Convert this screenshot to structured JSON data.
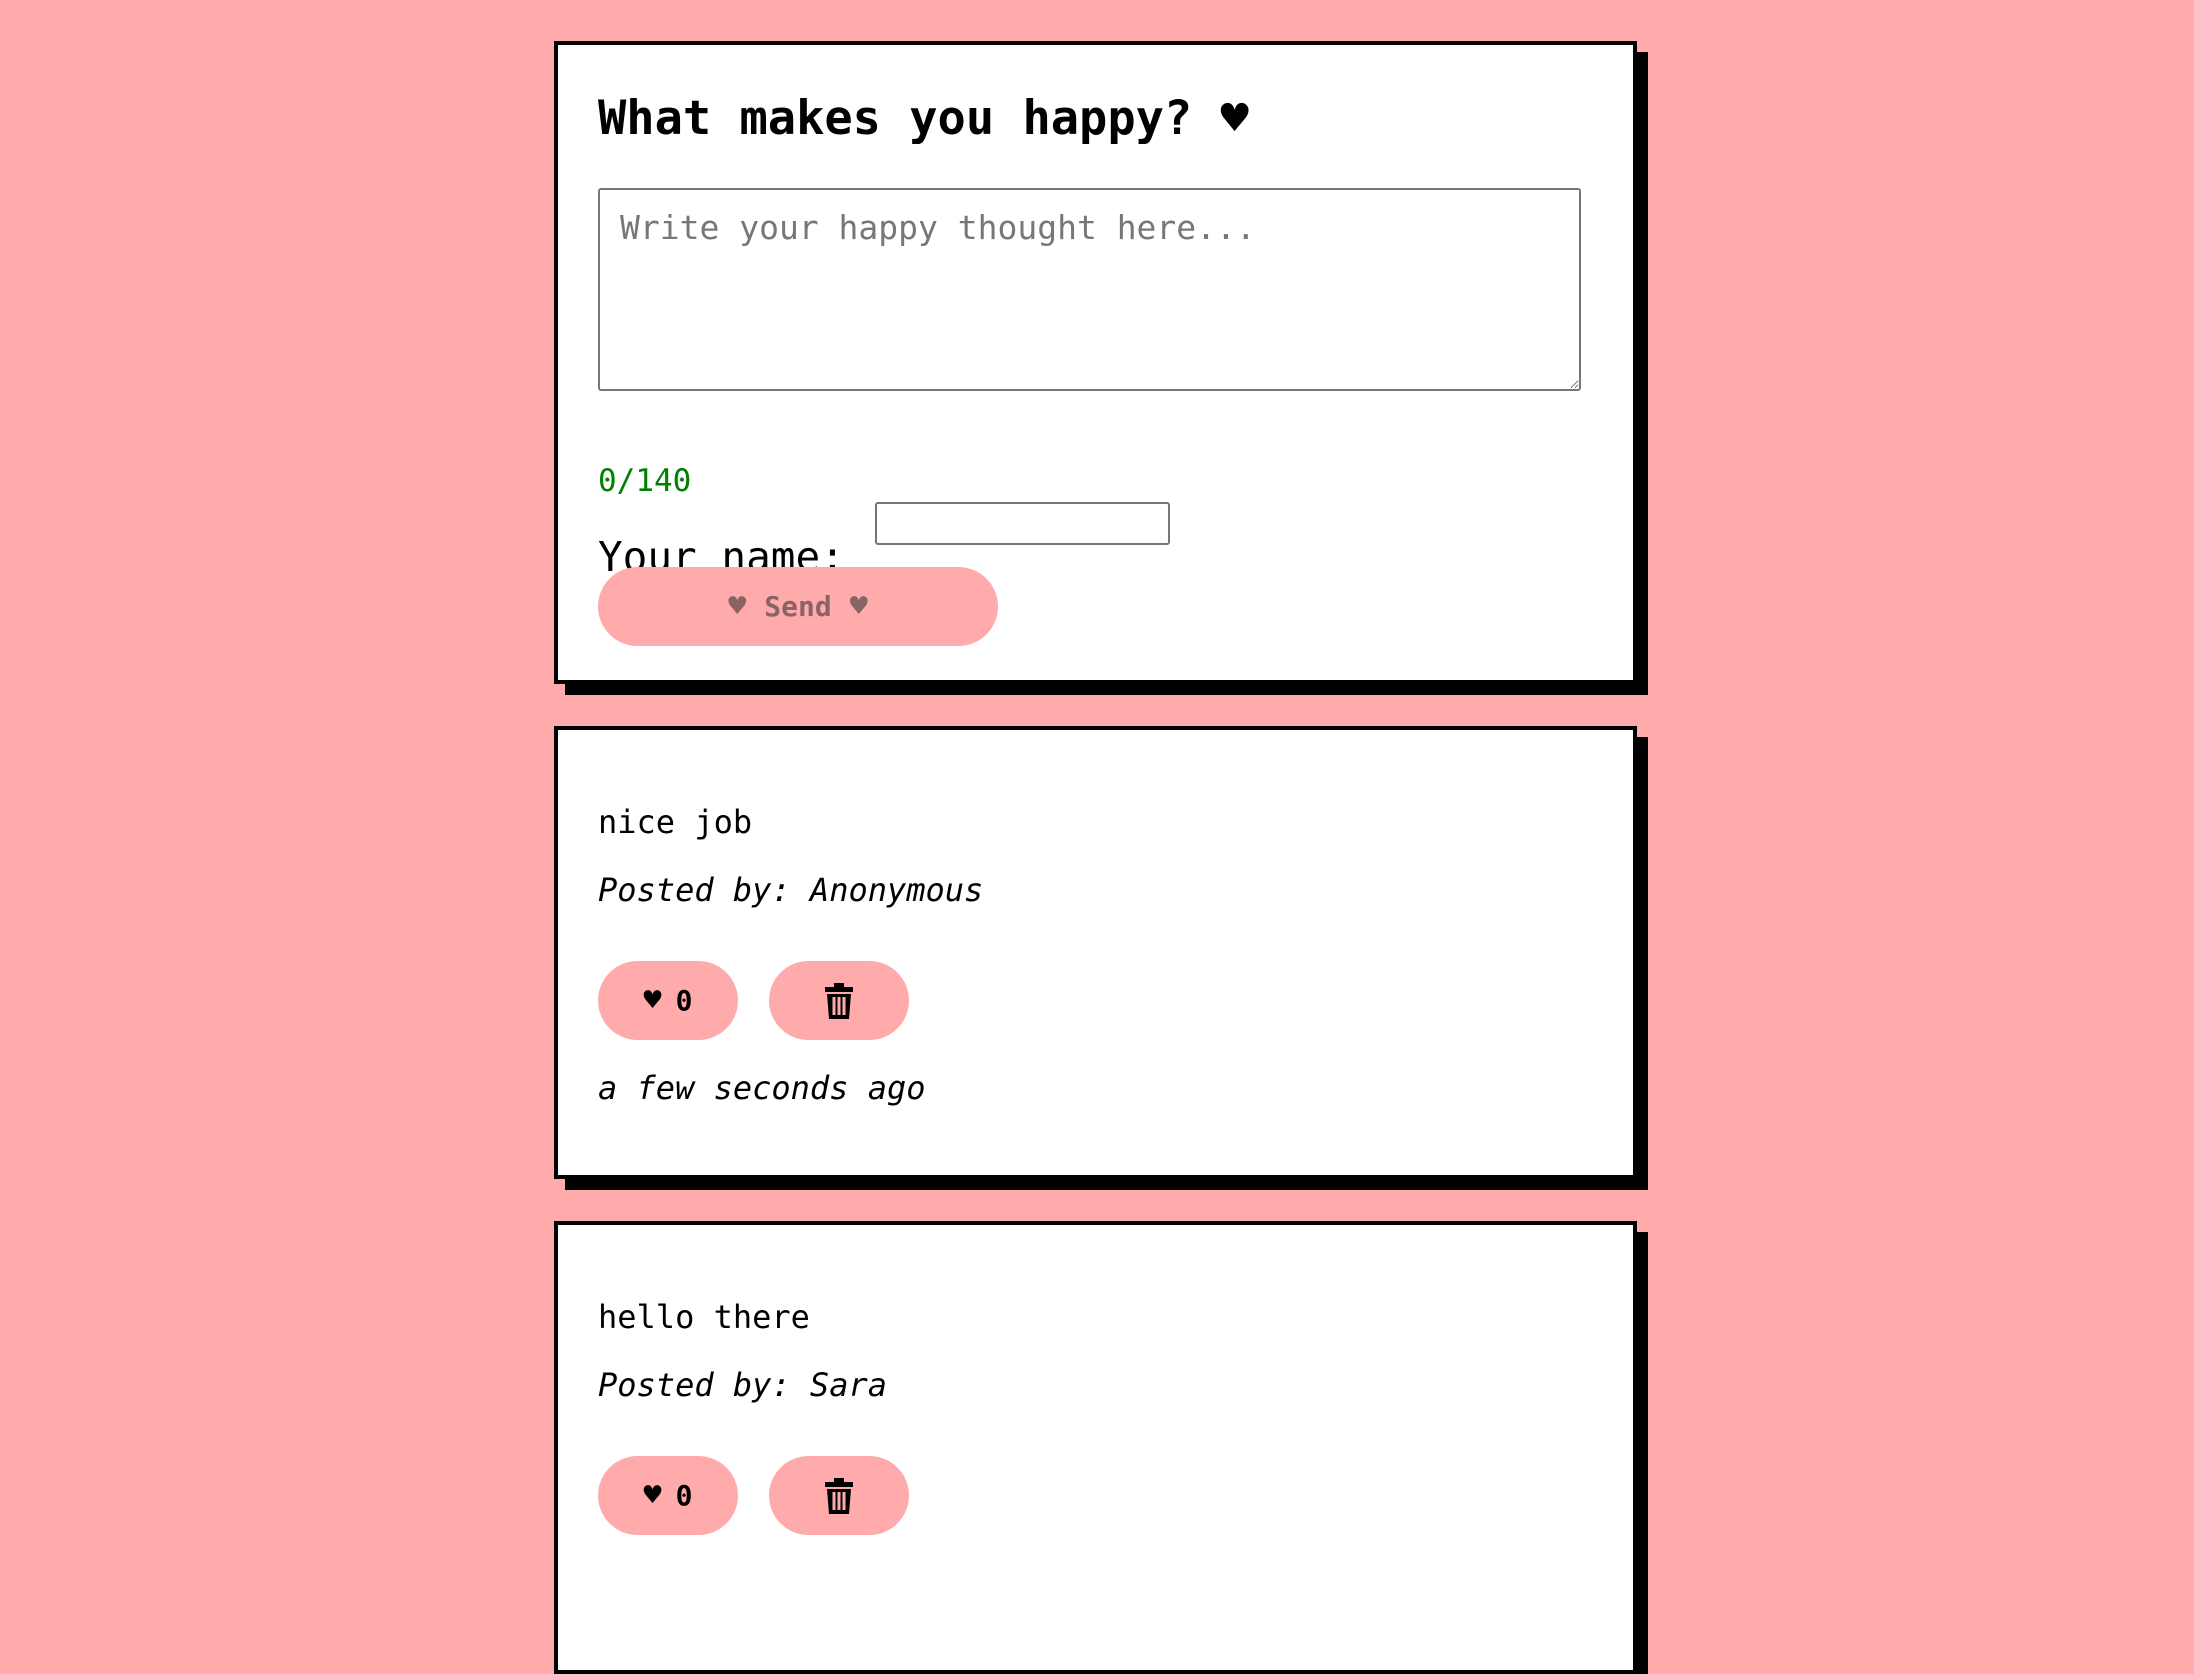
{
  "form": {
    "title": "What makes you happy? ♥",
    "thought_placeholder": "Write your happy thought here...",
    "thought_value": "",
    "char_count": "0/140",
    "name_label": "Your name:",
    "name_value": "",
    "send_label": "Send",
    "send_heart": "♥"
  },
  "posts": [
    {
      "message": "nice job",
      "author": "Posted by: Anonymous",
      "likes": "0",
      "time": "a few seconds ago"
    },
    {
      "message": "hello there",
      "author": "Posted by: Sara",
      "likes": "0",
      "time": ""
    }
  ],
  "icons": {
    "like": "heart-icon",
    "delete": "trash-icon"
  },
  "colors": {
    "background": "#ffabab",
    "button": "#ffabab",
    "counter": "#008000",
    "card": "#ffffff",
    "border": "#000000"
  }
}
